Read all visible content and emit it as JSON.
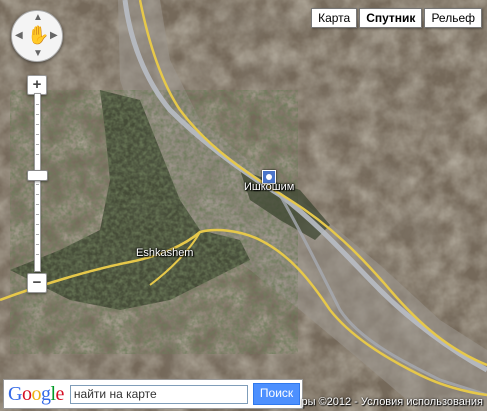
{
  "map_type": {
    "buttons": [
      {
        "label": "Карта",
        "active": false
      },
      {
        "label": "Спутник",
        "active": true
      },
      {
        "label": "Рельеф",
        "active": false
      }
    ]
  },
  "places": {
    "ishkoshim": "Ишкошим",
    "eshkashem": "Eshkashem"
  },
  "zoom": {
    "plus": "+",
    "minus": "−",
    "level_fraction": 0.45
  },
  "search": {
    "placeholder": "найти на карте",
    "value": "найти на карте",
    "button": "Поиск",
    "logo": [
      {
        "ch": "G",
        "color": "#3369e8"
      },
      {
        "ch": "o",
        "color": "#d50f25"
      },
      {
        "ch": "o",
        "color": "#eeb211"
      },
      {
        "ch": "g",
        "color": "#3369e8"
      },
      {
        "ch": "l",
        "color": "#009925"
      },
      {
        "ch": "e",
        "color": "#d50f25"
      }
    ]
  },
  "footer": {
    "text": "ры ©2012 - Условия использования"
  },
  "colors": {
    "road": "#e6c84a",
    "river": "#b8bcc4",
    "vegetation": "#3f4a2c",
    "terrain": "#6e6656"
  }
}
